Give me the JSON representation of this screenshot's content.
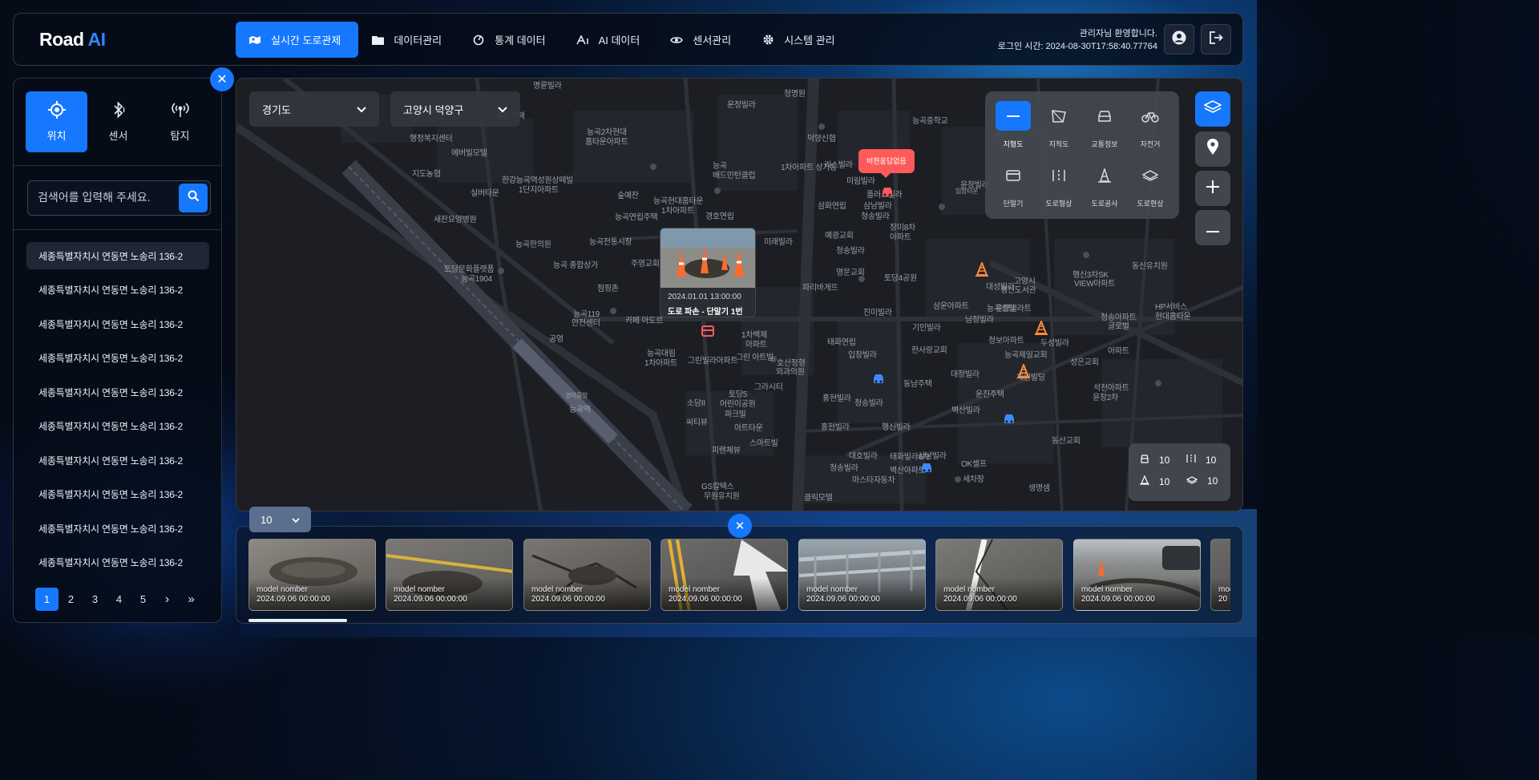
{
  "app": {
    "logo_main": "Road",
    "logo_accent": "AI"
  },
  "nav": [
    {
      "label": "실시간 도로관제",
      "icon": "map-icon",
      "active": true
    },
    {
      "label": "데이터관리",
      "icon": "folder-icon",
      "active": false
    },
    {
      "label": "통계 데이터",
      "icon": "chart-icon",
      "active": false
    },
    {
      "label": "AI 데이터",
      "icon": "ai-icon",
      "active": false
    },
    {
      "label": "센서관리",
      "icon": "eye-icon",
      "active": false
    },
    {
      "label": "시스템 관리",
      "icon": "gear-icon",
      "active": false
    }
  ],
  "user": {
    "welcome": "관리자님 환영합니다.",
    "login_time": "로그인 시간: 2024-08-30T17:58:40.77764"
  },
  "sidebar": {
    "tabs": [
      {
        "label": "위치",
        "icon": "location-icon",
        "active": true
      },
      {
        "label": "센서",
        "icon": "bluetooth-icon",
        "active": false
      },
      {
        "label": "탐지",
        "icon": "broadcast-icon",
        "active": false
      }
    ],
    "search_placeholder": "검색어를 입력해 주세요.",
    "addresses": [
      "세종특별자치시 연동면 노송리 136-2",
      "세종특별자치시 연동면 노송리 136-2",
      "세종특별자치시 연동면 노송리 136-2",
      "세종특별자치시 연동면 노송리 136-2",
      "세종특별자치시 연동면 노송리 136-2",
      "세종특별자치시 연동면 노송리 136-2",
      "세종특별자치시 연동면 노송리 136-2",
      "세종특별자치시 연동면 노송리 136-2",
      "세종특별자치시 연동면 노송리 136-2",
      "세종특별자치시 연동면 노송리 136-2"
    ],
    "pages": [
      "1",
      "2",
      "3",
      "4",
      "5"
    ],
    "current_page": "1",
    "next": "›",
    "last": "»"
  },
  "map": {
    "region": "경기도",
    "district": "고양시 덕양구",
    "layers": [
      {
        "label": "지형도",
        "active": true
      },
      {
        "label": "지적도",
        "active": false
      },
      {
        "label": "교통정보",
        "active": false
      },
      {
        "label": "자전거",
        "active": false
      },
      {
        "label": "단말기",
        "active": false
      },
      {
        "label": "도로형상",
        "active": false
      },
      {
        "label": "도로공사",
        "active": false
      },
      {
        "label": "도로현상",
        "active": false
      }
    ],
    "stats": {
      "vehicle": "10",
      "barrier": "10",
      "cone": "10",
      "surface": "10"
    },
    "popup": {
      "date": "2024.01.01 13:00:00",
      "title": "도로 파손 - 단말기 1번"
    },
    "alert": "비현응답없음",
    "labels": [
      "명륜빌라",
      "운정빌라",
      "청명원",
      "덕양신협",
      "리스빌라",
      "능곡중학교",
      "지도농협",
      "실버타운",
      "한강능곡역성원상떼빌",
      "1단지아파트",
      "숲예찬",
      "능곡현대홈타운",
      "1차아파트",
      "능곡연립주택",
      "경호연립",
      "삼화연립",
      "미림빌라",
      "플러스빌라",
      "삼남빌라",
      "청송빌라",
      "에버빌모텔",
      "행정복지센터",
      "능곡2차현대",
      "홈타운아파트",
      "새찬요양병원",
      "능곡한의원",
      "능곡전통시장",
      "능곡 종합상가",
      "주영교회",
      "점핑존",
      "능곡119",
      "안전센터",
      "카페 아도르",
      "능곡대림",
      "1차아파트",
      "그린빌라아파트",
      "1차백제",
      "아파트",
      "그린 아트빌",
      "호산정형",
      "외과의원",
      "태화연립",
      "입창빌라",
      "토당문화플랫폼",
      "능곡1904",
      "공영",
      "경의중앙",
      "능곡역",
      "미래빌라",
      "예광교회",
      "청송빌라",
      "영문교회",
      "토당4공원",
      "파리바게뜨",
      "진미빌라",
      "기민빌라",
      "한사랑교회",
      "삼운아파트",
      "대성빌라",
      "고양시",
      "행신도서관",
      "윤창빌라트",
      "남정빌라",
      "청보아파트",
      "능곡제일교회",
      "성은교회",
      "두성빌라",
      "재원빌딩",
      "대정빌라",
      "운진주택",
      "벽산빌라",
      "장미8차",
      "아파트",
      "토당5",
      "어린이공원",
      "파크빌",
      "아트타운",
      "그라시티",
      "소담II",
      "씨티뷰",
      "스마트빌",
      "피렌체뷰",
      "홍현빌라",
      "청송빌라",
      "홍현빌라",
      "행신빌라",
      "대호빌라",
      "태화빌라4차",
      "삼남빌라",
      "청송빌라",
      "벽산아파트",
      "마스타자동차",
      "OK셀프",
      "세차장",
      "GS칼텍스",
      "무원유치원",
      "클릭모텔",
      "생명샘",
      "동산교회",
      "석천아파트",
      "윤창2차",
      "아파트",
      "행신3차SK",
      "VIEW아파트",
      "청송아파트",
      "글로벌",
      "동신유치원",
      "HP서비스",
      "현대홈타운",
      "1차아파트 상가동",
      "능곡",
      "배드민턴클럽",
      "윤창빌라",
      "입창타운",
      "능곡성당",
      "동남주택",
      "동원주택"
    ]
  },
  "bottom": {
    "count": "10",
    "thumbs": [
      {
        "model": "model nomber",
        "date": "2024.09.06 00:00:00"
      },
      {
        "model": "model nomber",
        "date": "2024.09.06 00:00:00"
      },
      {
        "model": "model nomber",
        "date": "2024.09.06 00:00:00"
      },
      {
        "model": "model nomber",
        "date": "2024.09.06 00:00:00"
      },
      {
        "model": "model nomber",
        "date": "2024.09.06 00:00:00"
      },
      {
        "model": "model nomber",
        "date": "2024.09.06 00:00:00"
      },
      {
        "model": "model nomber",
        "date": "2024.09.06 00:00:00"
      },
      {
        "model": "mod",
        "date": "20"
      }
    ]
  },
  "colors": {
    "accent": "#1677ff",
    "alert": "#ff5a5a",
    "cone": "#ff8a3d",
    "vehicle": "#3b8cff"
  }
}
